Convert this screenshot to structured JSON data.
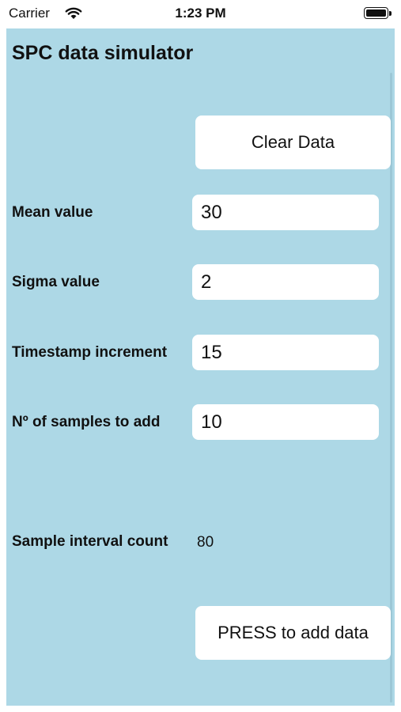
{
  "status_bar": {
    "carrier": "Carrier",
    "time": "1:23 PM",
    "wifi_icon": "wifi-icon",
    "battery_icon": "battery-icon",
    "battery_level": 1.0
  },
  "app": {
    "background_color": "#add8e6",
    "title": "SPC data simulator",
    "clear_button": "Clear Data",
    "fields": [
      {
        "label": "Mean value",
        "value": "30"
      },
      {
        "label": "Sigma value",
        "value": "2"
      },
      {
        "label": "Timestamp increment",
        "value": "15"
      },
      {
        "label": "Nº of samples to add",
        "value": "10"
      }
    ],
    "sample_interval": {
      "label": "Sample interval count",
      "value": "80"
    },
    "add_button": "PRESS to add data"
  }
}
